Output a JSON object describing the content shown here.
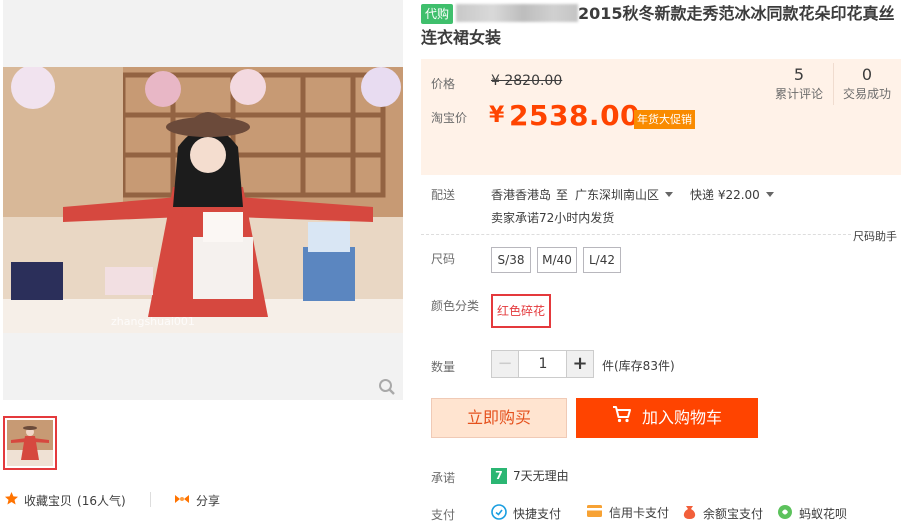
{
  "product": {
    "tag": "代购",
    "title": "2015秋冬新款走秀范冰冰同款花朵印花真丝连衣裙女装",
    "watermark": "zhangshuai001"
  },
  "actions": {
    "favorite_label": "收藏宝贝",
    "favorite_count": "(16人气)",
    "share_label": "分享"
  },
  "price": {
    "orig_label": "价格",
    "orig_value": "¥ 2820.00",
    "current_label": "淘宝价",
    "currency": "¥",
    "current_value": "2538.00",
    "promo": "年货大促销"
  },
  "stats": [
    {
      "num": "5",
      "label": "累计评论"
    },
    {
      "num": "0",
      "label": "交易成功"
    }
  ],
  "shipping": {
    "label": "配送",
    "from": "香港香港岛",
    "to_word": "至",
    "dest": "广东深圳南山区",
    "express": "快递 ¥22.00",
    "promise": "卖家承诺72小时内发货",
    "size_help": "尺码助手"
  },
  "size": {
    "label": "尺码",
    "options": [
      "S/38",
      "M/40",
      "L/42"
    ]
  },
  "color": {
    "label": "颜色分类",
    "options": [
      "红色碎花"
    ],
    "selected": "红色碎花"
  },
  "quantity": {
    "label": "数量",
    "value": "1",
    "minus": "−",
    "plus": "+",
    "unit": "件(库存83件)"
  },
  "buttons": {
    "buy_now": "立即购买",
    "add_cart": "加入购物车"
  },
  "promise": {
    "label": "承诺",
    "item": "7天无理由",
    "icon_text": "7"
  },
  "payment": {
    "label": "支付",
    "methods": [
      "快捷支付",
      "信用卡支付",
      "余额宝支付",
      "蚂蚁花呗"
    ]
  },
  "colors": {
    "accent": "#ff4400",
    "price": "#ff4400",
    "tag_green": "#3fbf6c",
    "promo_orange": "#f98b00",
    "selected_border": "#e4393c"
  }
}
